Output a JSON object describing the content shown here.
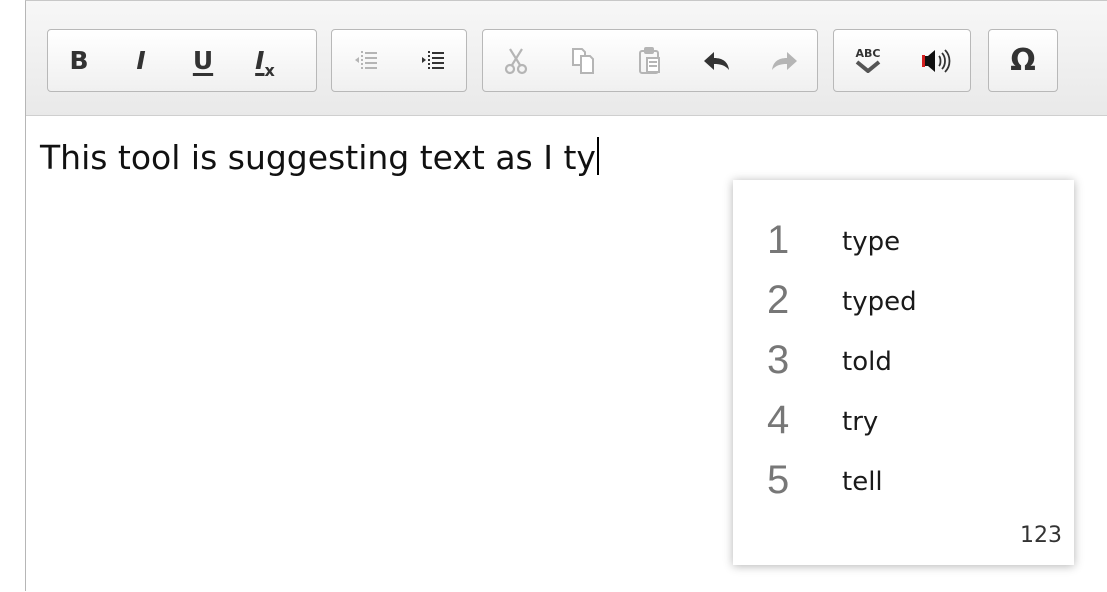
{
  "toolbar": {
    "groups": [
      {
        "name": "formatting",
        "buttons": [
          {
            "icon": "bold-icon",
            "glyph": "B",
            "enabled": true
          },
          {
            "icon": "italic-icon",
            "glyph": "I",
            "enabled": true
          },
          {
            "icon": "underline-icon",
            "glyph": "U",
            "enabled": true
          },
          {
            "icon": "remove-format-icon",
            "glyph": "I",
            "sub": "x",
            "enabled": true
          }
        ]
      },
      {
        "name": "indent",
        "buttons": [
          {
            "icon": "outdent-icon",
            "enabled": false
          },
          {
            "icon": "indent-icon",
            "enabled": true
          }
        ]
      },
      {
        "name": "clipboard-history",
        "buttons": [
          {
            "icon": "cut-icon",
            "enabled": false
          },
          {
            "icon": "copy-icon",
            "enabled": false
          },
          {
            "icon": "paste-icon",
            "enabled": false
          },
          {
            "icon": "undo-icon",
            "enabled": true
          },
          {
            "icon": "redo-icon",
            "enabled": false
          }
        ]
      },
      {
        "name": "tools",
        "buttons": [
          {
            "icon": "spellcheck-icon",
            "glyph": "ABC",
            "enabled": true
          },
          {
            "icon": "speaker-icon",
            "enabled": true
          }
        ]
      },
      {
        "name": "special",
        "buttons": [
          {
            "icon": "omega-icon",
            "glyph": "Ω",
            "enabled": true
          }
        ]
      }
    ]
  },
  "editor": {
    "text": "This tool is suggesting text as I ty"
  },
  "suggestions": {
    "items": [
      {
        "num": "1",
        "word": "type"
      },
      {
        "num": "2",
        "word": "typed"
      },
      {
        "num": "3",
        "word": "told"
      },
      {
        "num": "4",
        "word": "try"
      },
      {
        "num": "5",
        "word": "tell"
      }
    ],
    "footer": "123"
  },
  "colors": {
    "icon_enabled": "#333333",
    "icon_disabled": "#b5b5b5",
    "number": "#777777"
  }
}
